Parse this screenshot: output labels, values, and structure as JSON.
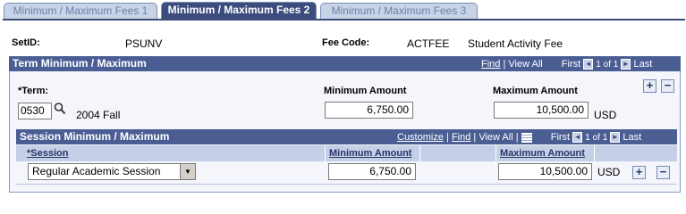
{
  "tabs": [
    {
      "label": "Minimum / Maximum Fees 1"
    },
    {
      "label": "Minimum / Maximum Fees 2"
    },
    {
      "label": "Minimum / Maximum Fees 3"
    }
  ],
  "header": {
    "setid_label": "SetID:",
    "setid_value": "PSUNV",
    "feecode_label": "Fee Code:",
    "feecode_value": "ACTFEE",
    "feecode_desc": "Student Activity Fee"
  },
  "term_section": {
    "title": "Term Minimum / Maximum",
    "nav_find": "Find",
    "nav_sep": "|",
    "nav_viewall": "View All",
    "nav_first": "First",
    "nav_counter": "1 of 1",
    "nav_last": "Last",
    "term_label": "*Term:",
    "term_value": "0530",
    "term_desc": "2004 Fall",
    "min_label": "Minimum Amount",
    "min_value": "6,750.00",
    "max_label": "Maximum Amount",
    "max_value": "10,500.00",
    "currency": "USD"
  },
  "session_section": {
    "title": "Session Minimum / Maximum",
    "nav_customize": "Customize",
    "nav_find": "Find",
    "nav_viewall": "View All",
    "nav_first": "First",
    "nav_counter": "1 of 1",
    "nav_last": "Last",
    "columns": [
      "*Session",
      "Minimum Amount",
      "Maximum Amount"
    ],
    "rows": [
      {
        "session": "Regular Academic Session",
        "min": "6,750.00",
        "max": "10,500.00",
        "currency": "USD"
      }
    ]
  },
  "buttons": {
    "add": "+",
    "remove": "−"
  },
  "icons": {
    "lookup": "magnifier-icon",
    "prev": "◄",
    "next": "►",
    "dropdown": "▼"
  }
}
